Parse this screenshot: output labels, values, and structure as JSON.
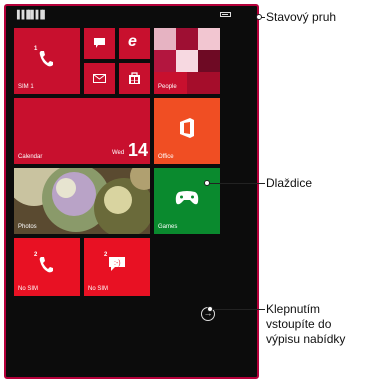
{
  "status_bar": {
    "signal_1": "▐▐▐▌",
    "signal_2": "▐▐▐▌",
    "icons": [
      "signal-sim1-icon",
      "signal-sim2-icon",
      "battery-icon"
    ]
  },
  "tiles": {
    "sim1": {
      "label": "SIM 1",
      "badge": "1"
    },
    "people": {
      "label": "People"
    },
    "calendar": {
      "label": "Calendar",
      "day": "Wed",
      "date": "14"
    },
    "office": {
      "label": "Office"
    },
    "photos": {
      "label": "Photos"
    },
    "games": {
      "label": "Games"
    },
    "nosim_phone": {
      "label": "No SIM",
      "badge": "2"
    },
    "nosim_msg": {
      "label": "No SIM",
      "badge": "2"
    }
  },
  "callouts": {
    "status_bar": "Stavový pruh",
    "tiles": "Dlaždice",
    "app_list_line1": "Klepnutím",
    "app_list_line2": "vstoupíte do",
    "app_list_line3": "výpisu nabídky"
  },
  "colors": {
    "frame": "#b5003a",
    "tile_red": "#c8102e",
    "tile_orange": "#f04e23",
    "tile_green": "#0a8a2e"
  }
}
